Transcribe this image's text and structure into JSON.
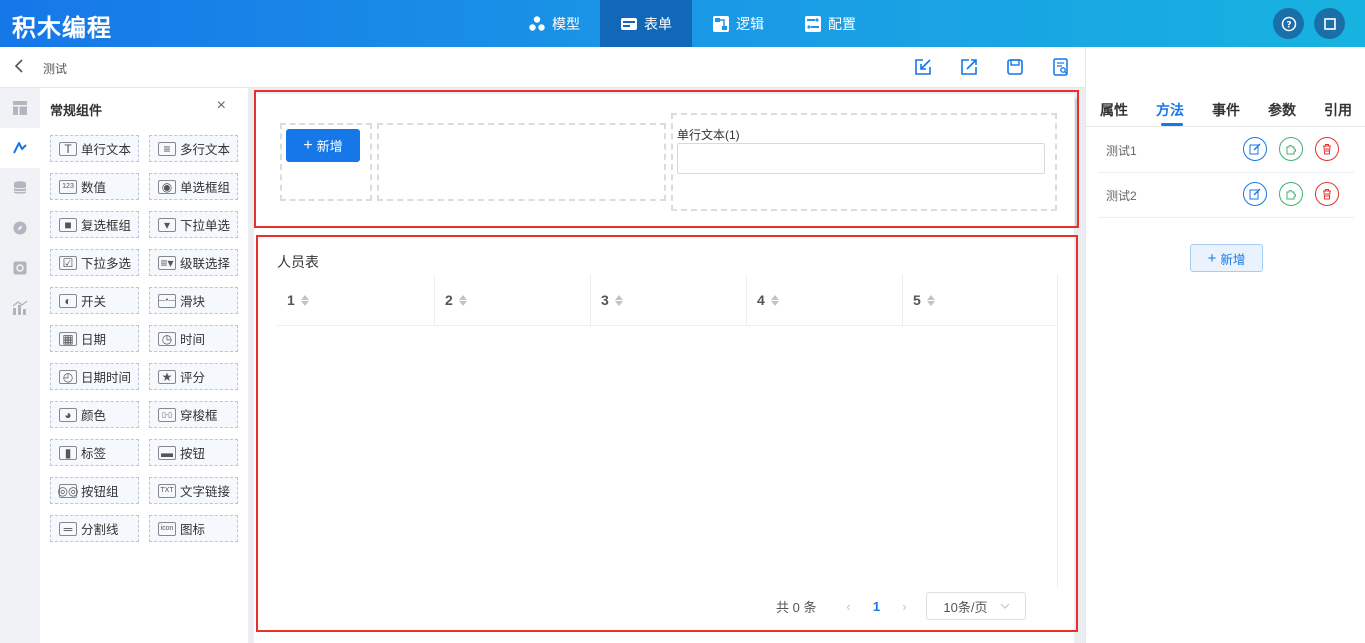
{
  "app": {
    "logo": "积木编程"
  },
  "topnav": [
    {
      "label": "模型",
      "icon": "model-icon",
      "active": false
    },
    {
      "label": "表单",
      "icon": "form-icon",
      "active": true
    },
    {
      "label": "逻辑",
      "icon": "logic-icon",
      "active": false
    },
    {
      "label": "配置",
      "icon": "config-icon",
      "active": false
    }
  ],
  "subheader": {
    "title": "测试"
  },
  "components": {
    "title": "常规组件",
    "close": "×",
    "items": [
      {
        "label": "单行文本",
        "icon": "single-text-icon",
        "glyph": "T"
      },
      {
        "label": "多行文本",
        "icon": "multi-text-icon",
        "glyph": "≡"
      },
      {
        "label": "数值",
        "icon": "number-icon",
        "glyph": "123"
      },
      {
        "label": "单选框组",
        "icon": "radio-icon",
        "glyph": "◉"
      },
      {
        "label": "复选框组",
        "icon": "checkbox-icon",
        "glyph": "■"
      },
      {
        "label": "下拉单选",
        "icon": "dropdown-icon",
        "glyph": "▾"
      },
      {
        "label": "下拉多选",
        "icon": "multi-dropdown-icon",
        "glyph": "☑"
      },
      {
        "label": "级联选择",
        "icon": "cascade-icon",
        "glyph": "≡▾"
      },
      {
        "label": "开关",
        "icon": "switch-icon",
        "glyph": "◐"
      },
      {
        "label": "滑块",
        "icon": "slider-icon",
        "glyph": "—•—"
      },
      {
        "label": "日期",
        "icon": "date-icon",
        "glyph": "▦"
      },
      {
        "label": "时间",
        "icon": "time-icon",
        "glyph": "◷"
      },
      {
        "label": "日期时间",
        "icon": "datetime-icon",
        "glyph": "◴"
      },
      {
        "label": "评分",
        "icon": "rate-icon",
        "glyph": "★"
      },
      {
        "label": "颜色",
        "icon": "color-icon",
        "glyph": "◕"
      },
      {
        "label": "穿梭框",
        "icon": "transfer-icon",
        "glyph": "▯-▯"
      },
      {
        "label": "标签",
        "icon": "tag-icon",
        "glyph": "▮"
      },
      {
        "label": "按钮",
        "icon": "button-icon",
        "glyph": "▬"
      },
      {
        "label": "按钮组",
        "icon": "button-group-icon",
        "glyph": "◎◎"
      },
      {
        "label": "文字链接",
        "icon": "text-link-icon",
        "glyph": "TXT"
      },
      {
        "label": "分割线",
        "icon": "divider-icon",
        "glyph": "═"
      },
      {
        "label": "图标",
        "icon": "image-icon",
        "glyph": "icon"
      }
    ]
  },
  "canvas": {
    "add_button": "新增",
    "add_plus": "+",
    "field_label": "单行文本(1)",
    "field_value": "",
    "table_title": "人员表",
    "columns": [
      "1",
      "2",
      "3",
      "4",
      "5"
    ],
    "pager": {
      "total": "共 0 条",
      "current": "1",
      "page_size": "10条/页",
      "prev": "‹",
      "next": "›"
    }
  },
  "right_panel": {
    "tabs": [
      "属性",
      "方法",
      "事件",
      "参数",
      "引用"
    ],
    "active_tab": "方法",
    "methods": [
      "测试1",
      "测试2"
    ],
    "add_button": "新增",
    "add_plus": "+"
  },
  "colors": {
    "primary": "#1677e8",
    "danger": "#e5322d",
    "success": "#3fb16a",
    "topbar_active": "#1168b8"
  }
}
